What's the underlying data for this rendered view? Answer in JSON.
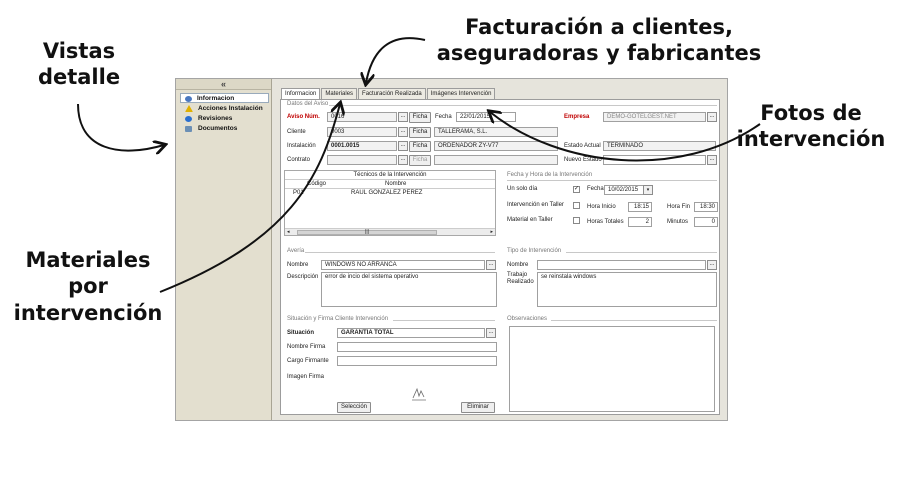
{
  "callouts": {
    "vistas": [
      "Vistas",
      "detalle"
    ],
    "facturacion": [
      "Facturación a clientes,",
      "aseguradoras y fabricantes"
    ],
    "fotos": [
      "Fotos de",
      "intervención"
    ],
    "materiales": [
      "Materiales",
      "por",
      "intervención"
    ]
  },
  "app": {
    "collapse_glyph": "«",
    "sidebar": [
      {
        "label": "Informacion",
        "icon": "info-icon"
      },
      {
        "label": "Acciones Instalación",
        "icon": "warning-icon"
      },
      {
        "label": "Revisiones",
        "icon": "revisions-icon"
      },
      {
        "label": "Documentos",
        "icon": "documents-icon"
      }
    ],
    "tabs": [
      "Informacion",
      "Materiales",
      "Facturación Realizada",
      "Imágenes Intervención"
    ],
    "datos_aviso": {
      "section": "Datos del Aviso",
      "aviso_label": "Aviso Núm.",
      "aviso_value": "0016",
      "fecha_label": "Fecha",
      "fecha_value": "22/01/2015",
      "empresa_label": "Empresa",
      "empresa_value": "DEMO-GOTELGEST.NET",
      "cliente_label": "Cliente",
      "cliente_code": "0003",
      "cliente_name": "TALLERAMA, S.L.",
      "instalacion_label": "Instalación",
      "instalacion_code": "0001.0015",
      "instalacion_name": "ORDENADOR ZY-V77",
      "contrato_label": "Contrato",
      "estado_actual_label": "Estado Actual",
      "estado_actual_value": "TERMINADO",
      "nuevo_estado_label": "Nuevo Estado",
      "ficha_label": "Ficha",
      "dots": "..."
    },
    "tecnicos": {
      "title": "Técnicos de la Intervención",
      "col_codigo": "Código",
      "col_nombre": "Nombre",
      "rows": [
        {
          "codigo": "P01",
          "nombre": "RAUL GONZALEZ PEREZ"
        }
      ],
      "scroll_left": "◂",
      "scroll_right": "▸",
      "scroll_grip": "|||"
    },
    "fecha_hora": {
      "section": "Fecha y Hora de la Intervención",
      "solo_dia_label": "Un solo día",
      "fecha_label": "Fecha",
      "fecha_value": "10/02/2015",
      "intervencion_taller_label": "Intervención en Taller",
      "hora_inicio_label": "Hora Inicio",
      "hora_inicio_value": "18:15",
      "hora_fin_label": "Hora Fin",
      "hora_fin_value": "18:30",
      "material_taller_label": "Material en Taller",
      "horas_totales_label": "Horas Totales",
      "horas_totales_value": "2",
      "minutos_label": "Minutos",
      "minutos_value": "0",
      "check_mark": "✓"
    },
    "averia": {
      "section": "Avería",
      "nombre_label": "Nombre",
      "nombre_value": "WINDOWS NO ARRANCA",
      "descripcion_label": "Descripción",
      "descripcion_value": "error de incio del sistema operativo"
    },
    "tipo_intervencion": {
      "section": "Tipo de Intervención",
      "nombre_label": "Nombre",
      "trabajo_label_1": "Trabajo",
      "trabajo_label_2": "Realizado",
      "trabajo_value": "se reinstala windows"
    },
    "situacion": {
      "section": "Situación y Firma Cliente Intervención",
      "situacion_label": "Situación",
      "situacion_value": "GARANTIA TOTAL",
      "nombre_firma_label": "Nombre Firma",
      "cargo_label": "Cargo Firmante",
      "imagen_label": "Imagen Firma",
      "seleccion_button": "Selección",
      "eliminar_button": "Eliminar"
    },
    "observaciones": {
      "section": "Observaciones"
    }
  }
}
